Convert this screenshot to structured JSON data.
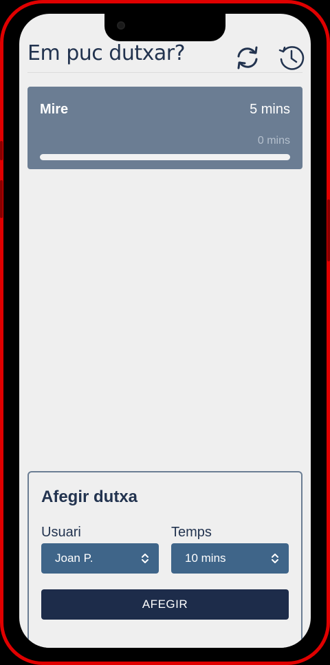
{
  "header": {
    "title": "Em puc dutxar?",
    "refresh_icon": "refresh-icon",
    "history_icon": "clock-icon"
  },
  "current_shower": {
    "user": "Mire",
    "duration": "5 mins",
    "remaining": "0 mins",
    "progress": 0
  },
  "add_shower": {
    "title": "Afegir dutxa",
    "user_label": "Usuari",
    "user_value": "Joan P.",
    "time_label": "Temps",
    "time_value": "10 mins",
    "submit_label": "AFEGIR"
  },
  "colors": {
    "frame": "#e00000",
    "title": "#22334f",
    "card": "#6b7d93",
    "select": "#3f6589",
    "button": "#1d2c4a"
  }
}
